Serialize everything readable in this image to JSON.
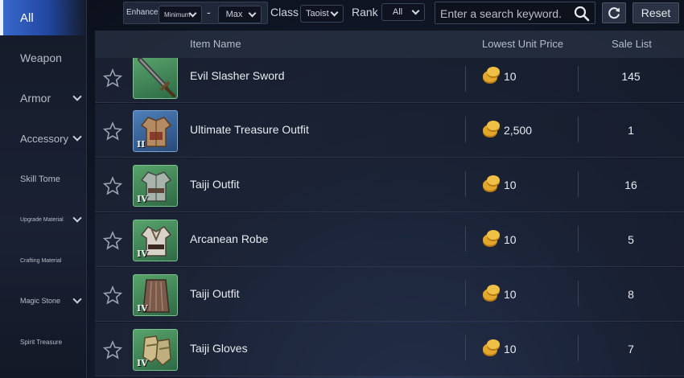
{
  "sidebar": {
    "items": [
      {
        "label": "All",
        "active": true,
        "chevron": false
      },
      {
        "label": "Weapon",
        "active": false,
        "chevron": false
      },
      {
        "label": "Armor",
        "active": false,
        "chevron": true
      },
      {
        "label": "Accessory",
        "active": false,
        "chevron": true
      },
      {
        "label": "Skill Tome",
        "active": false,
        "chevron": false
      },
      {
        "label": "Upgrade Material",
        "active": false,
        "chevron": true
      },
      {
        "label": "Crafting Material",
        "active": false,
        "chevron": false
      },
      {
        "label": "Magic Stone",
        "active": false,
        "chevron": true
      },
      {
        "label": "Spirit Treasure",
        "active": false,
        "chevron": false
      }
    ]
  },
  "filters": {
    "enhance_label": "Enhance",
    "enhance_min": "Minimum",
    "enhance_dash": "-",
    "enhance_max": "Max",
    "class_label": "Class",
    "class_value": "Taoist",
    "rank_label": "Rank",
    "rank_value": "All",
    "search_placeholder": "Enter a search keyword.",
    "reset_label": "Reset"
  },
  "table": {
    "headers": {
      "name": "Item Name",
      "price": "Lowest Unit Price",
      "sales": "Sale List"
    },
    "rows": [
      {
        "name": "Evil Slasher Sword",
        "price": "10",
        "sales": "145",
        "tier": "",
        "frame": "green",
        "item_icon": "sword-icon"
      },
      {
        "name": "Ultimate Treasure Outfit",
        "price": "2,500",
        "sales": "1",
        "tier": "II",
        "frame": "blue",
        "item_icon": "armor-outfit-icon"
      },
      {
        "name": "Taiji Outfit",
        "price": "10",
        "sales": "16",
        "tier": "IV",
        "frame": "green",
        "item_icon": "armor-outfit-icon"
      },
      {
        "name": "Arcanean Robe",
        "price": "10",
        "sales": "5",
        "tier": "IV",
        "frame": "green",
        "item_icon": "robe-icon"
      },
      {
        "name": "Taiji Outfit",
        "price": "10",
        "sales": "8",
        "tier": "IV",
        "frame": "green",
        "item_icon": "robe-skirt-icon"
      },
      {
        "name": "Taiji Gloves",
        "price": "10",
        "sales": "7",
        "tier": "IV",
        "frame": "green",
        "item_icon": "gloves-icon"
      }
    ]
  },
  "colors": {
    "accent": "#2f5fc4",
    "coin": "#e0a32a"
  }
}
